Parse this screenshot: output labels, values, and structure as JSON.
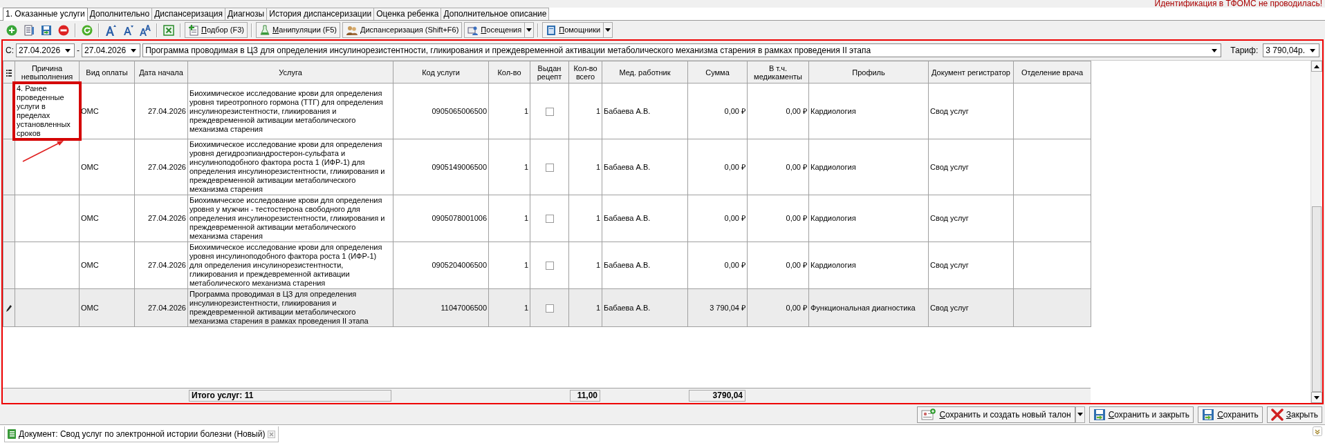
{
  "status_message": "Идентификация в ТФОМС не проводилась!",
  "tabs": [
    {
      "label": "1. Оказанные услуги",
      "selected": true
    },
    {
      "label": "Дополнительно",
      "selected": false
    },
    {
      "label": "Диспансеризация",
      "selected": false
    },
    {
      "label": "Диагнозы",
      "selected": false
    },
    {
      "label": "История диспансеризации",
      "selected": false
    },
    {
      "label": "Оценка ребенка",
      "selected": false
    },
    {
      "label": "Дополнительное описание",
      "selected": false
    }
  ],
  "toolbar_buttons": [
    {
      "label": "Подбор (F3)",
      "dropdown": false
    },
    {
      "label": "Манипуляции (F5)",
      "dropdown": false
    },
    {
      "label": "Диспансеризация (Shift+F6)",
      "dropdown": false
    },
    {
      "label": "Посещения",
      "dropdown": true
    },
    {
      "label": "Помощники",
      "dropdown": true
    }
  ],
  "filter": {
    "from_label": "С:",
    "date_from": "27.04.2026",
    "separator": "-",
    "date_to": "27.04.2026",
    "program": "Программа проводимая в ЦЗ для определения инсулинорезистентности, гликирования и преждевременной активации метаболического механизма старения в рамках проведения II этапа",
    "tariff_label": "Тариф:",
    "tariff": "3 790,04р."
  },
  "table": {
    "columns": [
      "Причина невыполнения",
      "Вид оплаты",
      "Дата начала",
      "Услуга",
      "Код услуги",
      "Кол-во",
      "Выдан рецепт",
      "Кол-во всего",
      "Мед. работник",
      "Сумма",
      "В т.ч. медикаменты",
      "Профиль",
      "Документ регистратор",
      "Отделение врача"
    ],
    "rows": [
      {
        "cause": "4. Ранее проведенные услуги в пределах установленных сроков",
        "cause_highlighted": true,
        "payment": "ОМС",
        "start_date": "27.04.2026",
        "service": "Биохимическое исследование крови для определения уровня тиреотропного гормона (ТТГ) для определения инсулинорезистентности, гликирования и преждевременной активации метаболического механизма старения",
        "code": "0905065006500",
        "qty": "1",
        "prescription_issued": false,
        "qty_total": "1",
        "worker": "Бабаева А.В.",
        "sum": "0,00 ₽",
        "drugs": "0,00 ₽",
        "profile": "Кардиология",
        "registrar_doc": "Свод услуг",
        "selected": false
      },
      {
        "cause_highlighted": false,
        "payment": "ОМС",
        "start_date": "27.04.2026",
        "service": "Биохимическое исследование крови для определения уровня дегидроэпиандростерон-сульфата и инсулиноподобного фактора роста 1 (ИФР-1) для определения инсулинорезистентности, гликирования и преждевременной активации метаболического механизма старения",
        "code": "0905149006500",
        "qty": "1",
        "prescription_issued": false,
        "qty_total": "1",
        "worker": "Бабаева А.В.",
        "sum": "0,00 ₽",
        "drugs": "0,00 ₽",
        "profile": "Кардиология",
        "registrar_doc": "Свод услуг",
        "selected": false
      },
      {
        "cause_highlighted": false,
        "payment": "ОМС",
        "start_date": "27.04.2026",
        "service": "Биохимическое исследование крови для определения уровня у мужчин - тестостерона свободного для определения инсулинорезистентности, гликирования и преждевременной активации метаболического механизма старения",
        "code": "0905078001006",
        "qty": "1",
        "prescription_issued": false,
        "qty_total": "1",
        "worker": "Бабаева А.В.",
        "sum": "0,00 ₽",
        "drugs": "0,00 ₽",
        "profile": "Кардиология",
        "registrar_doc": "Свод услуг",
        "selected": false
      },
      {
        "cause_highlighted": false,
        "payment": "ОМС",
        "start_date": "27.04.2026",
        "service": "Биохимическое исследование крови для определения уровня инсулиноподобного фактора роста 1 (ИФР-1) для определения инсулинорезистентности, гликирования и преждевременной активации метаболического механизма старения",
        "code": "0905204006500",
        "qty": "1",
        "prescription_issued": false,
        "qty_total": "1",
        "worker": "Бабаева А.В.",
        "sum": "0,00 ₽",
        "drugs": "0,00 ₽",
        "profile": "Кардиология",
        "registrar_doc": "Свод услуг",
        "selected": false
      },
      {
        "cause_highlighted": false,
        "payment": "ОМС",
        "start_date": "27.04.2026",
        "service": "Программа проводимая в ЦЗ для определения инсулинорезистентности, гликирования и преждевременной активации метаболического механизма старения в рамках проведения II этапа",
        "code": "11047006500",
        "qty": "1",
        "prescription_issued": false,
        "qty_total": "1",
        "worker": "Бабаева А.В.",
        "sum": "3 790,04 ₽",
        "drugs": "0,00 ₽",
        "profile": "Функциональная диагностика",
        "registrar_doc": "Свод услуг",
        "selected": true
      }
    ],
    "totals": {
      "services": "Итого услуг: 11",
      "qty_total": "11,00",
      "sum": "3790,04"
    }
  },
  "footer_buttons": [
    {
      "label": "Сохранить и создать новый талон",
      "dropdown": true
    },
    {
      "label": "Сохранить и закрыть",
      "dropdown": false
    },
    {
      "label": "Сохранить",
      "dropdown": false
    },
    {
      "label": "Закрыть",
      "dropdown": false
    }
  ],
  "document_tab": {
    "title": "Документ: Свод услуг по электронной истории болезни (Новый)"
  }
}
